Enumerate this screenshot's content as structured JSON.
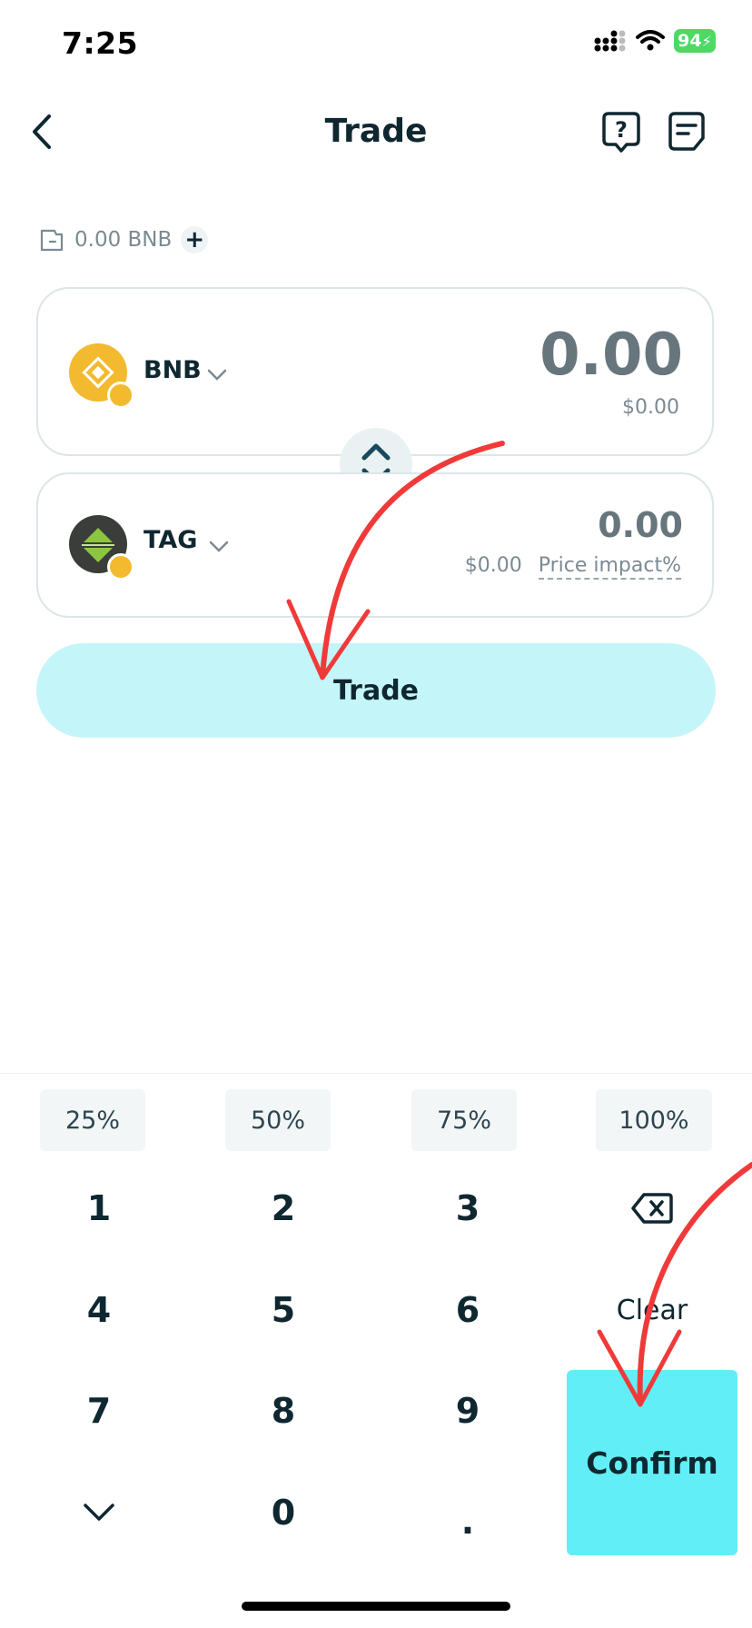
{
  "status_bar": {
    "time": "7:25",
    "battery": "94"
  },
  "header": {
    "title": "Trade"
  },
  "balance": {
    "text": "0.00 BNB",
    "add_label": "+"
  },
  "from": {
    "symbol": "BNB",
    "amount": "0.00",
    "usd": "$0.00"
  },
  "to": {
    "symbol": "TAG",
    "amount": "0.00",
    "usd": "$0.00",
    "price_impact_label": "Price impact%"
  },
  "trade_button": {
    "label": "Trade"
  },
  "percent_buttons": [
    "25%",
    "50%",
    "75%",
    "100%"
  ],
  "keypad": {
    "keys": [
      "1",
      "2",
      "3",
      "4",
      "5",
      "6",
      "7",
      "8",
      "9",
      "0",
      "."
    ],
    "clear_label": "Clear",
    "confirm_label": "Confirm"
  },
  "colors": {
    "accent": "#62eef6",
    "trade_button": "#c4f6f9",
    "annotation": "#f03a3a",
    "bnb": "#f3ba2f",
    "tag_green": "#8cc63f"
  }
}
